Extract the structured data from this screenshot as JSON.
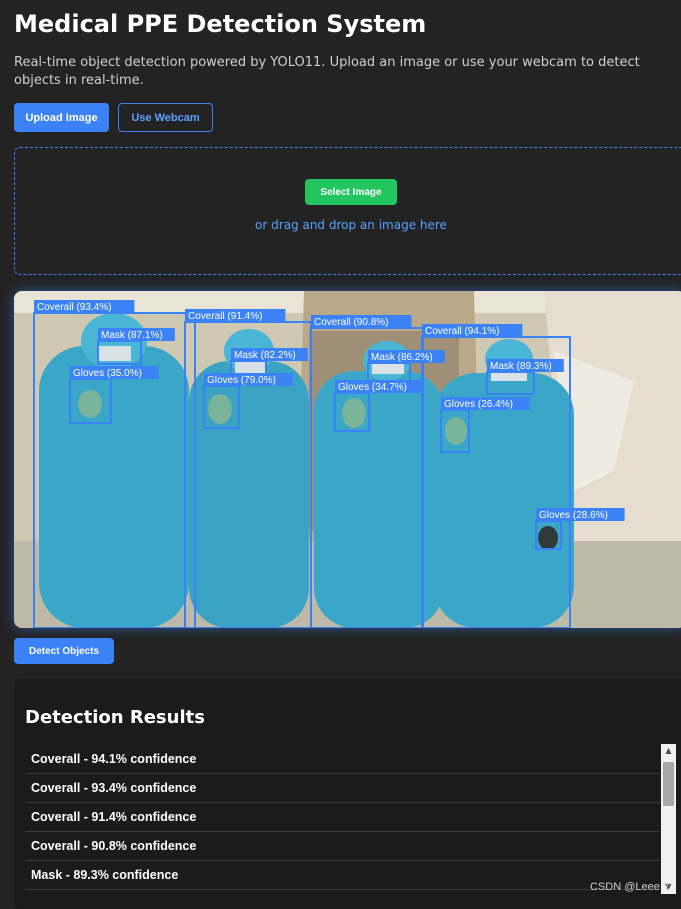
{
  "header": {
    "title": "Medical PPE Detection System",
    "subtitle": "Real-time object detection powered by YOLO11. Upload an image or use your webcam to detect objects in real-time."
  },
  "controls": {
    "upload_label": "Upload Image",
    "webcam_label": "Use Webcam"
  },
  "dropzone": {
    "select_label": "Select Image",
    "hint": "or drag and drop an image here"
  },
  "image": {
    "detections": [
      {
        "label": "Coverall (93.4%)"
      },
      {
        "label": "Coverall (91.4%)"
      },
      {
        "label": "Coverall (90.8%)"
      },
      {
        "label": "Coverall (94.1%)"
      },
      {
        "label": "Mask (87.1%)"
      },
      {
        "label": "Mask (82.2%)"
      },
      {
        "label": "Mask (86.2%)"
      },
      {
        "label": "Mask (89.3%)"
      },
      {
        "label": "Gloves (35.0%)"
      },
      {
        "label": "Gloves (79.0%)"
      },
      {
        "label": "Gloves (34.7%)"
      },
      {
        "label": "Gloves (26.4%)"
      },
      {
        "label": "Gloves (28.6%)"
      }
    ]
  },
  "detect_label": "Detect Objects",
  "results": {
    "title": "Detection Results",
    "items": [
      "Coverall - 94.1% confidence",
      "Coverall - 93.4% confidence",
      "Coverall - 91.4% confidence",
      "Coverall - 90.8% confidence",
      "Mask - 89.3% confidence"
    ]
  },
  "watermark": "CSDN @Leee Y",
  "colors": {
    "accent": "#3b82f6",
    "success": "#22c55e",
    "background": "#232323",
    "box": "#3b82f6",
    "ppe": "#3aa7c9"
  }
}
